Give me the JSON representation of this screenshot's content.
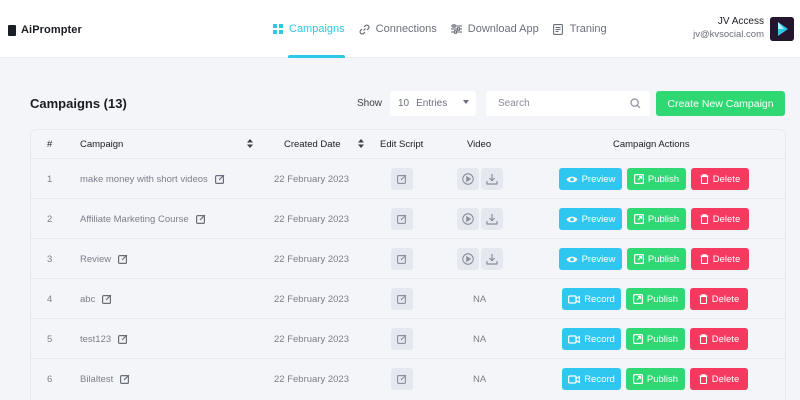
{
  "app": {
    "name": "AiPrompter"
  },
  "nav": {
    "items": [
      {
        "label": "Campaigns",
        "icon": "grid-icon",
        "active": true
      },
      {
        "label": "Connections",
        "icon": "link-icon",
        "active": false
      },
      {
        "label": "Download App",
        "icon": "sliders-icon",
        "active": false
      },
      {
        "label": "Traning",
        "icon": "document-icon",
        "active": false
      }
    ]
  },
  "user": {
    "name": "JV Access",
    "email": "jv@kvsocial.com"
  },
  "page": {
    "title": "Campaigns (13)"
  },
  "controls": {
    "show_label": "Show",
    "entries_value": "10",
    "entries_label": "Entries",
    "search_placeholder": "Search",
    "create_button": "Create New Campaign"
  },
  "table": {
    "headers": {
      "num": "#",
      "campaign": "Campaign",
      "created": "Created Date",
      "edit_script": "Edit Script",
      "video": "Video",
      "actions": "Campaign Actions"
    },
    "na_label": "NA",
    "actions": {
      "preview": "Preview",
      "record": "Record",
      "publish": "Publish",
      "delete": "Delete"
    },
    "rows": [
      {
        "num": "1",
        "campaign": "make money with short videos",
        "date": "22 February 2023",
        "has_video": true
      },
      {
        "num": "2",
        "campaign": "Affiliate Marketing Course",
        "date": "22 February 2023",
        "has_video": true
      },
      {
        "num": "3",
        "campaign": "Review",
        "date": "22 February 2023",
        "has_video": true
      },
      {
        "num": "4",
        "campaign": "abc",
        "date": "22 February 2023",
        "has_video": false
      },
      {
        "num": "5",
        "campaign": "test123",
        "date": "22 February 2023",
        "has_video": false
      },
      {
        "num": "6",
        "campaign": "Bilaltest",
        "date": "22 February 2023",
        "has_video": false
      }
    ]
  },
  "colors": {
    "accent": "#2ec7e5",
    "preview": "#2fc6f0",
    "publish": "#2fd873",
    "delete": "#f5395f"
  }
}
